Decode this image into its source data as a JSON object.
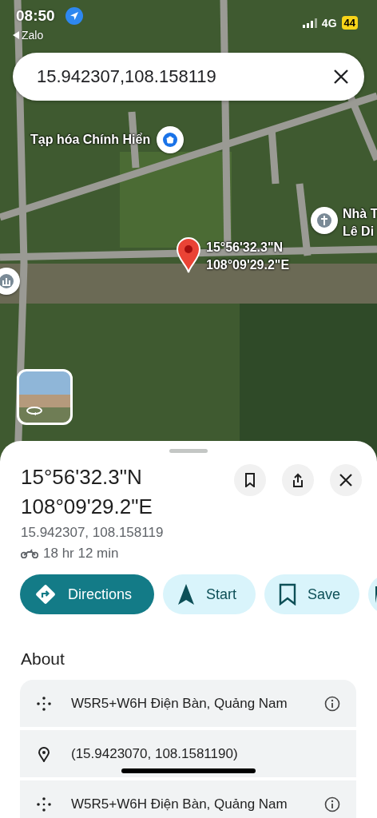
{
  "status_bar": {
    "time": "08:50",
    "back_app": "Zalo",
    "network": "4G",
    "battery": "44"
  },
  "search": {
    "value": "15.942307,108.158119"
  },
  "map": {
    "pin_label": [
      "15°56'32.3\"N",
      "108°09'29.2\"E"
    ],
    "places": [
      {
        "kind": "shop",
        "label": [
          "Tạp hóa Chính Hiển"
        ]
      },
      {
        "kind": "church",
        "label": [
          "Nhà T",
          "Lê Di"
        ]
      },
      {
        "kind": "monument"
      }
    ]
  },
  "place": {
    "title": [
      "15°56'32.3\"N",
      "108°09'29.2\"E"
    ],
    "coordinates": "15.942307, 108.158119",
    "travel_time": "18 hr 12 min",
    "actions": [
      {
        "kind": "directions",
        "label": "Directions"
      },
      {
        "kind": "start",
        "label": "Start"
      },
      {
        "kind": "save",
        "label": "Save"
      }
    ]
  },
  "about": {
    "heading": "About",
    "rows": [
      {
        "kind": "plus_code",
        "text": "W5R5+W6H Điện Bàn, Quảng Nam"
      },
      {
        "kind": "location",
        "text": "(15.9423070, 108.1581190)"
      },
      {
        "kind": "plus_code",
        "text": "W5R5+W6H Điện Bàn, Quảng Nam"
      }
    ]
  }
}
